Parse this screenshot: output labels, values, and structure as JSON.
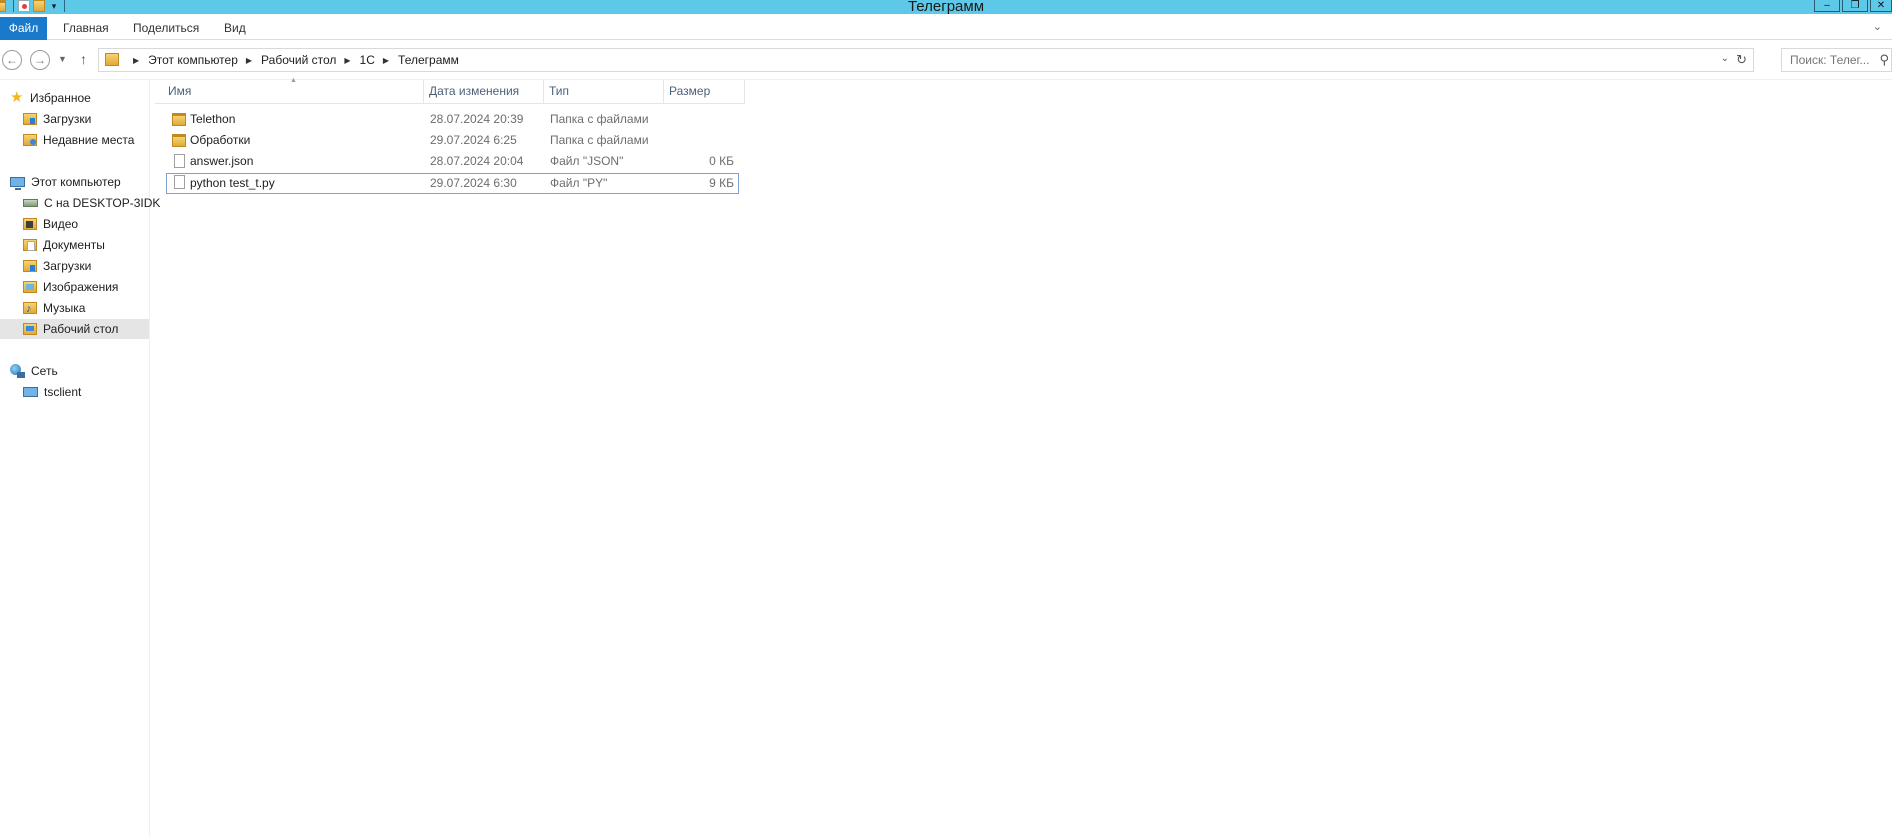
{
  "window": {
    "title": "Телеграмм",
    "controls": {
      "minimize": "–",
      "maximize": "❐",
      "close": "✕"
    }
  },
  "ribbon": {
    "tabs": [
      "Файл",
      "Главная",
      "Поделиться",
      "Вид"
    ],
    "accent": "#1979ca"
  },
  "titlebar_color": "#5ec8e8",
  "address": {
    "breadcrumbs": [
      "Этот компьютер",
      "Рабочий стол",
      "1С",
      "Телеграмм"
    ],
    "search_placeholder": "Поиск: Телег..."
  },
  "nav_pane": {
    "favorites": {
      "label": "Избранное",
      "items": [
        "Загрузки",
        "Недавние места"
      ]
    },
    "computer": {
      "label": "Этот компьютер",
      "items": [
        "С на DESKTOP-3IDK",
        "Видео",
        "Документы",
        "Загрузки",
        "Изображения",
        "Музыка",
        "Рабочий стол"
      ],
      "selected": "Рабочий стол"
    },
    "network": {
      "label": "Сеть",
      "items": [
        "tsclient"
      ]
    }
  },
  "columns": {
    "name": "Имя",
    "date": "Дата изменения",
    "type": "Тип",
    "size": "Размер"
  },
  "files": [
    {
      "name": "Telethon",
      "date": "28.07.2024 20:39",
      "type": "Папка с файлами",
      "size": "",
      "icon": "folder-icon"
    },
    {
      "name": "Обработки",
      "date": "29.07.2024 6:25",
      "type": "Папка с файлами",
      "size": "",
      "icon": "folder-icon"
    },
    {
      "name": "answer.json",
      "date": "28.07.2024 20:04",
      "type": "Файл \"JSON\"",
      "size": "0 КБ",
      "icon": "file-icon"
    },
    {
      "name": "python test_t.py",
      "date": "29.07.2024 6:30",
      "type": "Файл \"PY\"",
      "size": "9 КБ",
      "icon": "file-icon",
      "selected": true
    }
  ]
}
